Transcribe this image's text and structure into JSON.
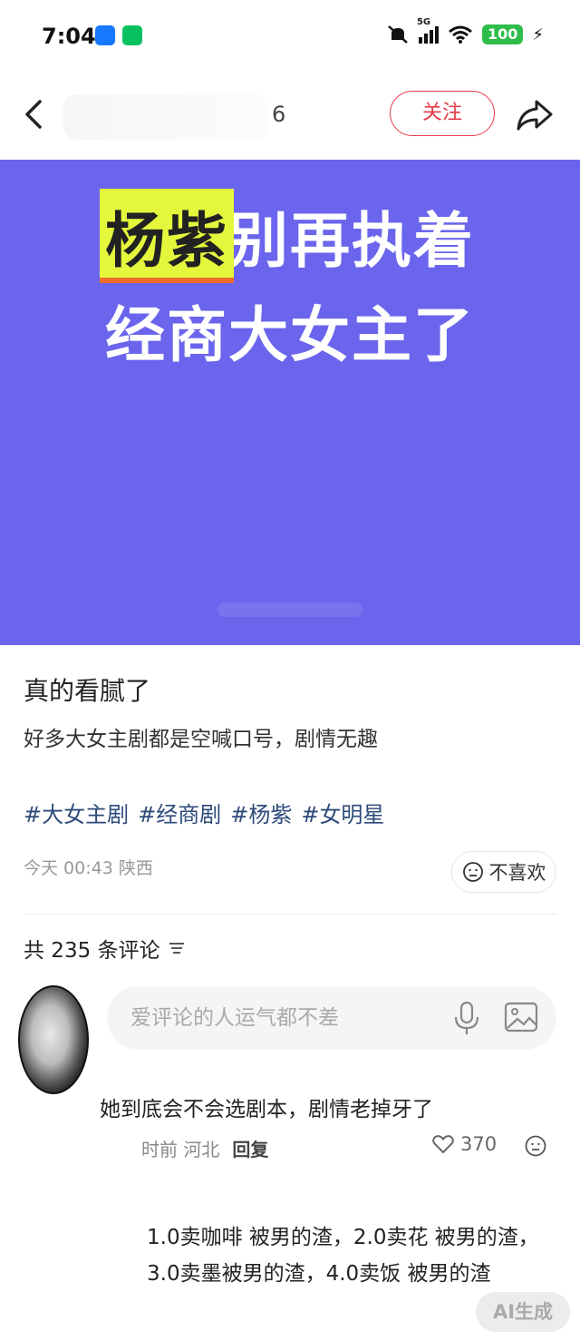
{
  "status_bar": {
    "time": "7:04",
    "network": "5G",
    "battery": "100"
  },
  "nav": {
    "title": "6",
    "follow_label": "关注"
  },
  "cover": {
    "highlight": "杨紫",
    "line1_rest": "别再执着",
    "line2": "经商大女主了"
  },
  "post": {
    "title": "真的看腻了",
    "body": "好多大女主剧都是空喊口号，剧情无趣",
    "tags": [
      "#大女主剧",
      "#经商剧",
      "#杨紫",
      "#女明星"
    ],
    "meta": "今天 00:43 陕西",
    "dislike_label": "不喜欢"
  },
  "comments": {
    "count_label": "共 235 条评论",
    "input_placeholder": "爱评论的人运气都不差",
    "items": [
      {
        "text": "她到底会不会选剧本，剧情老掉牙了",
        "time_loc": "时前 河北",
        "reply": "回复",
        "likes": "370"
      },
      {
        "text": "1.0卖咖啡 被男的渣，2.0卖花 被男的渣，3.0卖墨被男的渣，4.0卖饭 被男的渣"
      }
    ]
  },
  "ai_badge": "AI生成",
  "colors": {
    "cover_bg": "#6a65ec",
    "accent_red": "#e33b4a",
    "tag_blue": "#2d4a7a",
    "highlight": "#e4f73c"
  }
}
